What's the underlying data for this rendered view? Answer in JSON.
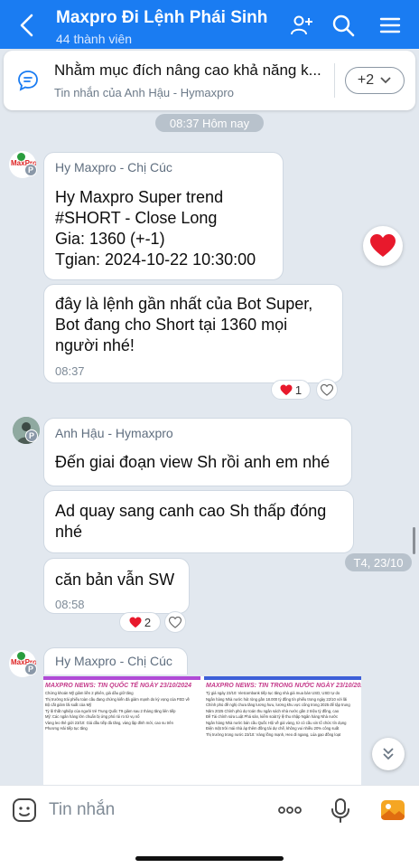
{
  "header": {
    "title": "Maxpro Đi Lệnh Phái Sinh",
    "members": "44 thành viên",
    "bg_color": "#1a7cf2"
  },
  "pinned": {
    "text": "Nhằm mục đích nâng cao khả năng k...",
    "sub": "Tin nhắn của Anh Hậu - Hymaxpro",
    "more_label": "+2"
  },
  "time_pill": "08:37 Hôm nay",
  "date_pill": "T4, 23/10",
  "avatar_badge": "P",
  "avatar_text": "MaxPro",
  "messages": [
    {
      "sender": "Hy Maxpro - Chị Cúc",
      "text": "Hy Maxpro Super trend\n#SHORT - Close Long\nGia: 1360 (+-1)\nTgian: 2024-10-22 10:30:00"
    },
    {
      "text": "đây là lệnh gần nhất của Bot Super,\nBot đang cho Short tại 1360 mọi\nngười nhé!",
      "time": "08:37",
      "reaction_count": "1"
    },
    {
      "sender": "Anh Hậu - Hymaxpro",
      "text": "Đến giai đoạn view Sh rồi anh em nhé"
    },
    {
      "text": "Ad quay sang canh cao Sh thấp đóng\nnhé"
    },
    {
      "text": "căn bản vẫn SW",
      "time": "08:58",
      "reaction_count": "2"
    },
    {
      "sender": "Hy Maxpro - Chị Cúc"
    }
  ],
  "news": {
    "left_title": "MAXPRO NEWS: TIN QUỐC TẾ NGÀY 23/10/2024",
    "right_title": "MAXPRO NEWS: TIN TRONG NƯỚC NGÀY 23/10/2024",
    "left_lines": [
      "Chứng khoán Mỹ giảm liền 2 phiên, giá dầu giữ tăng",
      "Thị trường trái phiếu toàn cầu đang chứng kiến đà giảm mạnh do kỳ vọng của FED về",
      "Bộ cắt giảm lãi suất của Mỹ",
      "Tỷ lệ thất nghiệp của người trẻ Trung Quốc T9 giảm sau 2 tháng tăng liên tiếp",
      "Mỹ: Các ngân hàng lớn chuẩn bị ứng phó rủi ro từ vụ nổ",
      "Vàng leo thẻ giới 23/10: Giá dầu tiếp đà tăng, vàng lập đỉnh mới, cao su trên",
      "Phương Hải tiếp tục tăng"
    ],
    "right_lines": [
      "Tỷ giá ngày 23/10: Vietcombank tiếp tục tăng nhà giá mua bán USD, USD tự do",
      "Ngân hàng Nhà nước hút ròng gần 18.000 tỷ đồng tín phiếu trong ngày 22/10 với lãi",
      "Chính phủ đề nghị chưa tăng lương hưu, lương khu vực công trong 2025 để tập trung",
      "Năm 2025 Chính phủ dự toán thu ngân sách nhà nước gần 2 triệu tỷ đồng, cao",
      "Đề Tài chính sửa Luật Phá sản, kiểm soát tỷ lệ thu nhập Ngân hàng Nhà nước",
      "Ngân hàng Nhà nước bán cầu Quốc Hội về giá vàng, từ có cầu xin tổ chức tín dụng",
      "Điện mặt trời mái nhà áp thêm đồng tái dự chế, không vui nhiều 20% công suất",
      "Thị trường trong nước 23/10: Vàng lồng mạnh, Heo đi ngang, Lúa gạo đồng loạt"
    ]
  },
  "composer": {
    "placeholder": "Tin nhắn"
  }
}
